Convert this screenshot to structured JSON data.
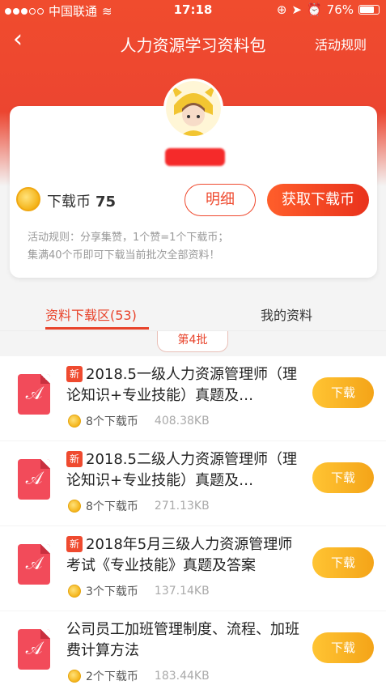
{
  "status": {
    "carrier": "中国联通",
    "time": "17:18",
    "battery": "76%"
  },
  "nav": {
    "title": "人力资源学习资料包",
    "rules_link": "活动规则"
  },
  "account": {
    "coin_label": "下载币",
    "coin_count": "75",
    "detail_button": "明细",
    "get_coins_button": "获取下载币",
    "rules_line1": "活动规则：分享集赞，1个赞=1个下载币；",
    "rules_line2": "集满40个币即可下载当前批次全部资料！"
  },
  "tabs": [
    {
      "label": "资料下载区(53)"
    },
    {
      "label": "我的资料"
    }
  ],
  "batch_label": "第4批",
  "items": [
    {
      "badge": "新",
      "title": "2018.5一级人力资源管理师（理论知识+专业技能）真题及…",
      "cost": "8个下载币",
      "size": "408.38KB",
      "button": "下载"
    },
    {
      "badge": "新",
      "title": "2018.5二级人力资源管理师（理论知识+专业技能）真题及…",
      "cost": "8个下载币",
      "size": "271.13KB",
      "button": "下载"
    },
    {
      "badge": "新",
      "title": "2018年5月三级人力资源管理师考试《专业技能》真题及答案",
      "cost": "3个下载币",
      "size": "137.14KB",
      "button": "下载"
    },
    {
      "badge": "",
      "title": "公司员工加班管理制度、流程、加班费计算方法",
      "cost": "2个下载币",
      "size": "183.44KB",
      "button": "下载"
    }
  ],
  "colors": {
    "primary": "#ef4a2f",
    "download_button": "#f4a418"
  }
}
